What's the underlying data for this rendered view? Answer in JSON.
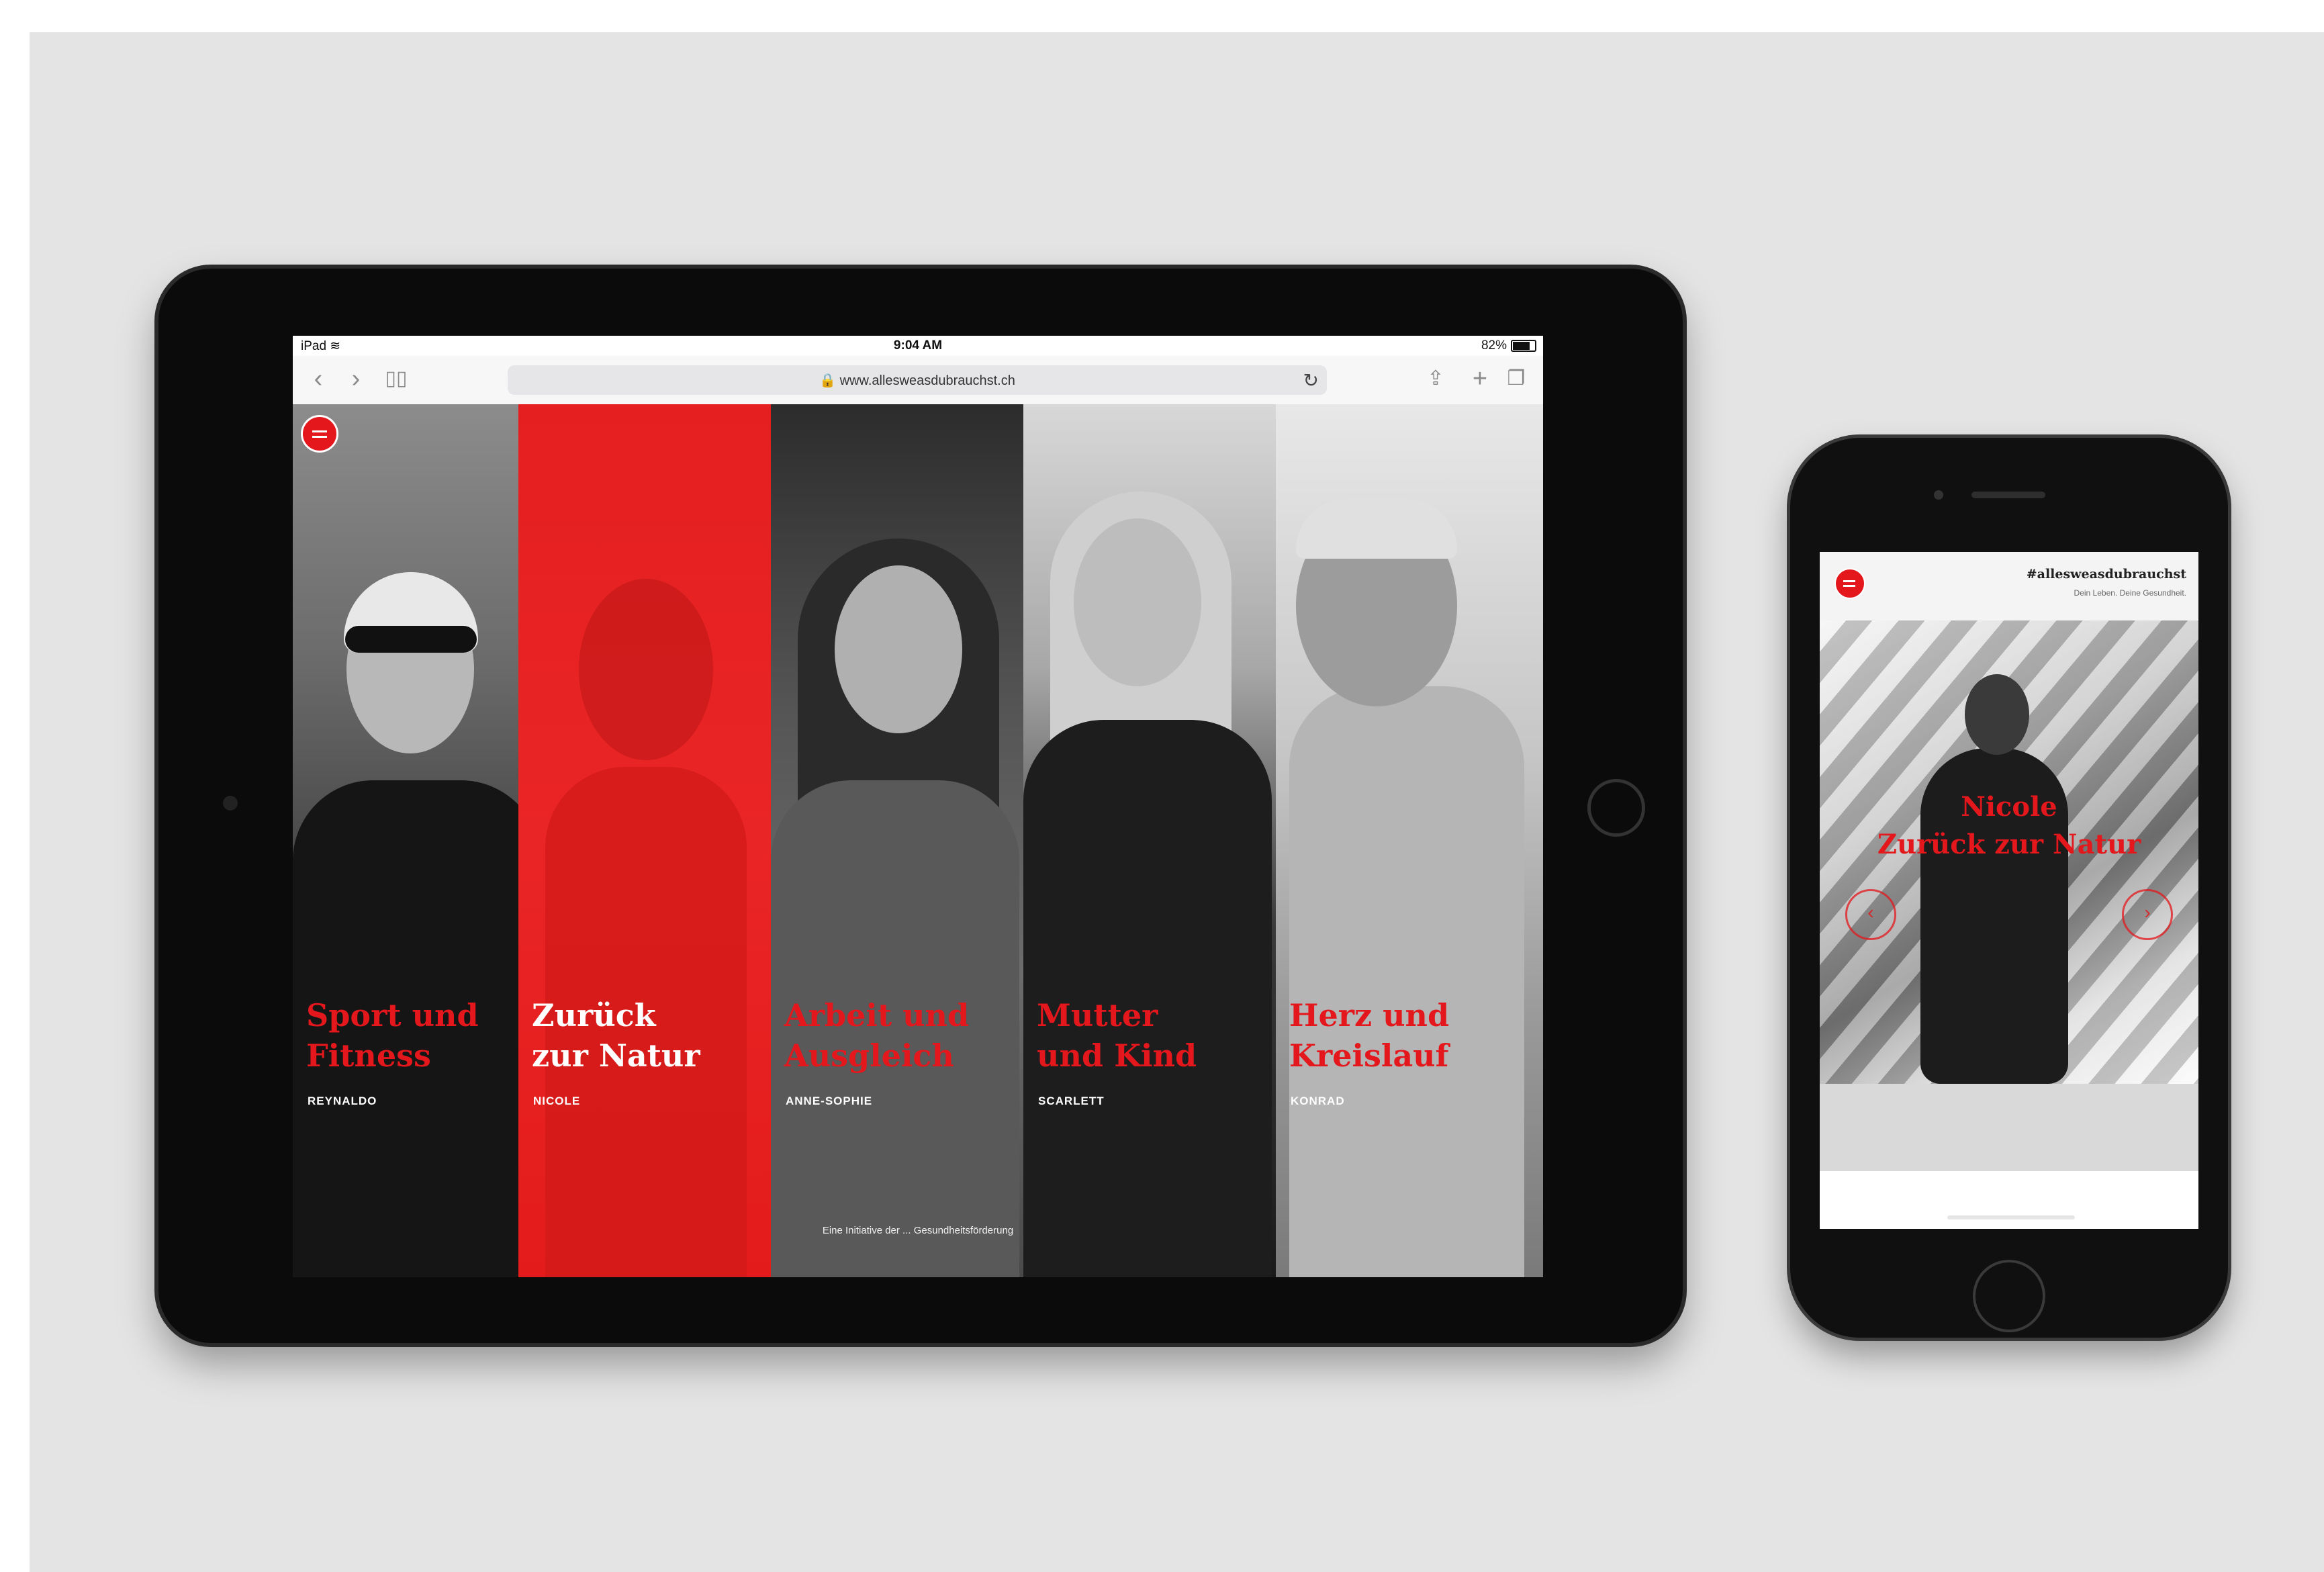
{
  "ipad": {
    "status": {
      "device": "iPad ≋",
      "time": "9:04 AM",
      "battery": "82%"
    },
    "browser": {
      "url": "🔒 www.allesweasdubrauchst.ch",
      "icons": {
        "back": "chevron-left-icon",
        "forward": "chevron-right-icon",
        "bookmarks": "book-icon",
        "reload": "reload-icon",
        "share": "share-icon",
        "new_tab": "plus-icon",
        "tabs": "tabs-icon"
      }
    },
    "panels": [
      {
        "title_line1": "Sport und",
        "title_line2": "Fitness",
        "name": "REYNALDO"
      },
      {
        "title_line1": "Zurück",
        "title_line2": "zur Natur",
        "name": "NICOLE"
      },
      {
        "title_line1": "Arbeit und",
        "title_line2": "Ausgleich",
        "name": "ANNE-SOPHIE"
      },
      {
        "title_line1": "Mutter",
        "title_line2": "und Kind",
        "name": "SCARLETT"
      },
      {
        "title_line1": "Herz und",
        "title_line2": "Kreislauf",
        "name": "KONRAD"
      }
    ],
    "footer": "Eine Initiative der ... Gesundheitsförderung"
  },
  "iphone": {
    "hashtag": "#allesweasdubrauchst",
    "subtitle": "Dein Leben. Deine Gesundheit.",
    "hero_title_line1": "Nicole",
    "hero_title_line2": "Zurück zur Natur",
    "left_arrow": "‹",
    "right_arrow": "›"
  },
  "colors": {
    "brand_red": "#e3171c",
    "background": "#e4e4e4",
    "device": "#0b0b0b"
  }
}
